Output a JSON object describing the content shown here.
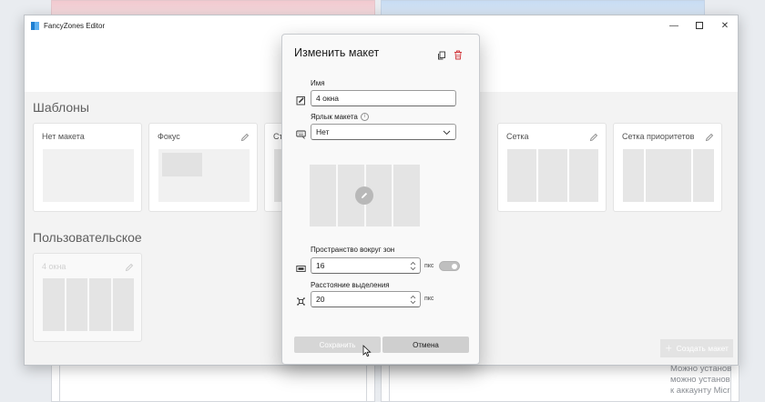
{
  "window": {
    "title": "FancyZones Editor",
    "controls": {
      "minimize": "—",
      "close": "✕"
    }
  },
  "sections": {
    "templates": "Шаблоны",
    "custom": "Пользовательское"
  },
  "templates": [
    {
      "label": "Нет макета"
    },
    {
      "label": "Фокус"
    },
    {
      "label": "Ст"
    },
    {
      "label": "Сетка"
    },
    {
      "label": "Сетка приоритетов"
    }
  ],
  "custom_layouts": [
    {
      "label": "4 окна"
    }
  ],
  "create_button": {
    "label": "Создать макет",
    "icon": "plus-icon"
  },
  "dialog": {
    "title": "Изменить макет",
    "name": {
      "label": "Имя",
      "value": "4 окна"
    },
    "shortcut": {
      "label": "Ярлык макета",
      "value": "Нет"
    },
    "preview": {
      "zones": 4
    },
    "spacing": {
      "label": "Пространство вокруг зон",
      "value": "16",
      "unit": "пкс",
      "enabled": true
    },
    "sensitivity": {
      "label": "Расстояние выделения",
      "value": "20",
      "unit": "пкс"
    },
    "save_label": "Сохранить",
    "cancel_label": "Отмена"
  },
  "background_text": [
    "Можно установ",
    "можно установ",
    "к аккаунту Micr"
  ]
}
